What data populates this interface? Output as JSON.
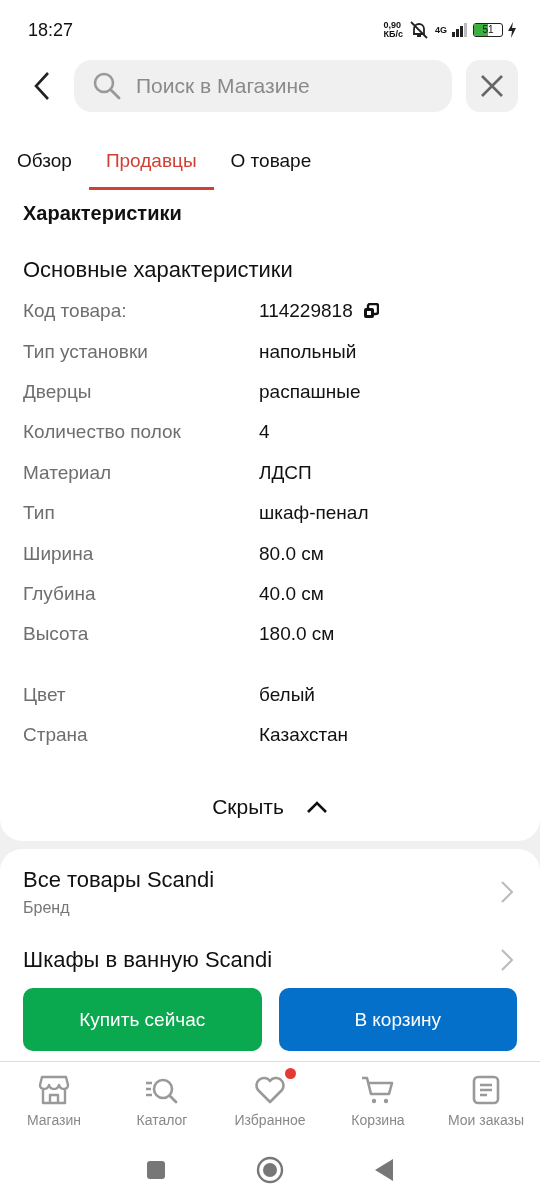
{
  "status_bar": {
    "time": "18:27",
    "speed": "0,90",
    "speed_unit": "КБ/с",
    "network": "4G",
    "battery": "51"
  },
  "search": {
    "placeholder": "Поиск в Магазине"
  },
  "tabs": [
    {
      "label": "Обзор",
      "selected": false
    },
    {
      "label": "Продавцы",
      "selected": true
    },
    {
      "label": "О товаре",
      "selected": false
    }
  ],
  "section_title": "Характеристики",
  "specs_title": "Основные характеристики",
  "spec_groups": [
    [
      {
        "name": "Код товара:",
        "value": "114229818",
        "kind": "code"
      },
      {
        "name": "Тип установки",
        "value": "напольный",
        "kind": "plain"
      },
      {
        "name": "Дверцы",
        "value": "распашные",
        "kind": "plain"
      },
      {
        "name": "Количество полок",
        "value": "4",
        "kind": "plain"
      },
      {
        "name": "Материал",
        "value": "ЛДСП",
        "kind": "plain"
      },
      {
        "name": "Тип",
        "value": "шкаф-пенал",
        "kind": "plain"
      },
      {
        "name": "Ширина",
        "value": "80.0 см",
        "kind": "plain"
      },
      {
        "name": "Глубина",
        "value": "40.0 см",
        "kind": "plain"
      },
      {
        "name": "Высота",
        "value": "180.0 см",
        "kind": "plain"
      }
    ],
    [
      {
        "name": "Цвет",
        "value": "белый",
        "kind": "plain"
      },
      {
        "name": "Страна",
        "value": "Казахстан",
        "kind": "plain"
      }
    ]
  ],
  "collapse_label": "Скрыть",
  "links": [
    {
      "title": "Все товары Scandi",
      "subtitle": "Бренд"
    },
    {
      "title": "Шкафы в ванную Scandi"
    }
  ],
  "buy_now": "Купить сейчас",
  "add_to_cart": "В корзину",
  "nav": [
    {
      "label": "Магазин",
      "badge": false
    },
    {
      "label": "Каталог",
      "badge": false
    },
    {
      "label": "Избранное",
      "badge": true
    },
    {
      "label": "Корзина",
      "badge": false
    },
    {
      "label": "Мои заказы",
      "badge": false
    }
  ]
}
